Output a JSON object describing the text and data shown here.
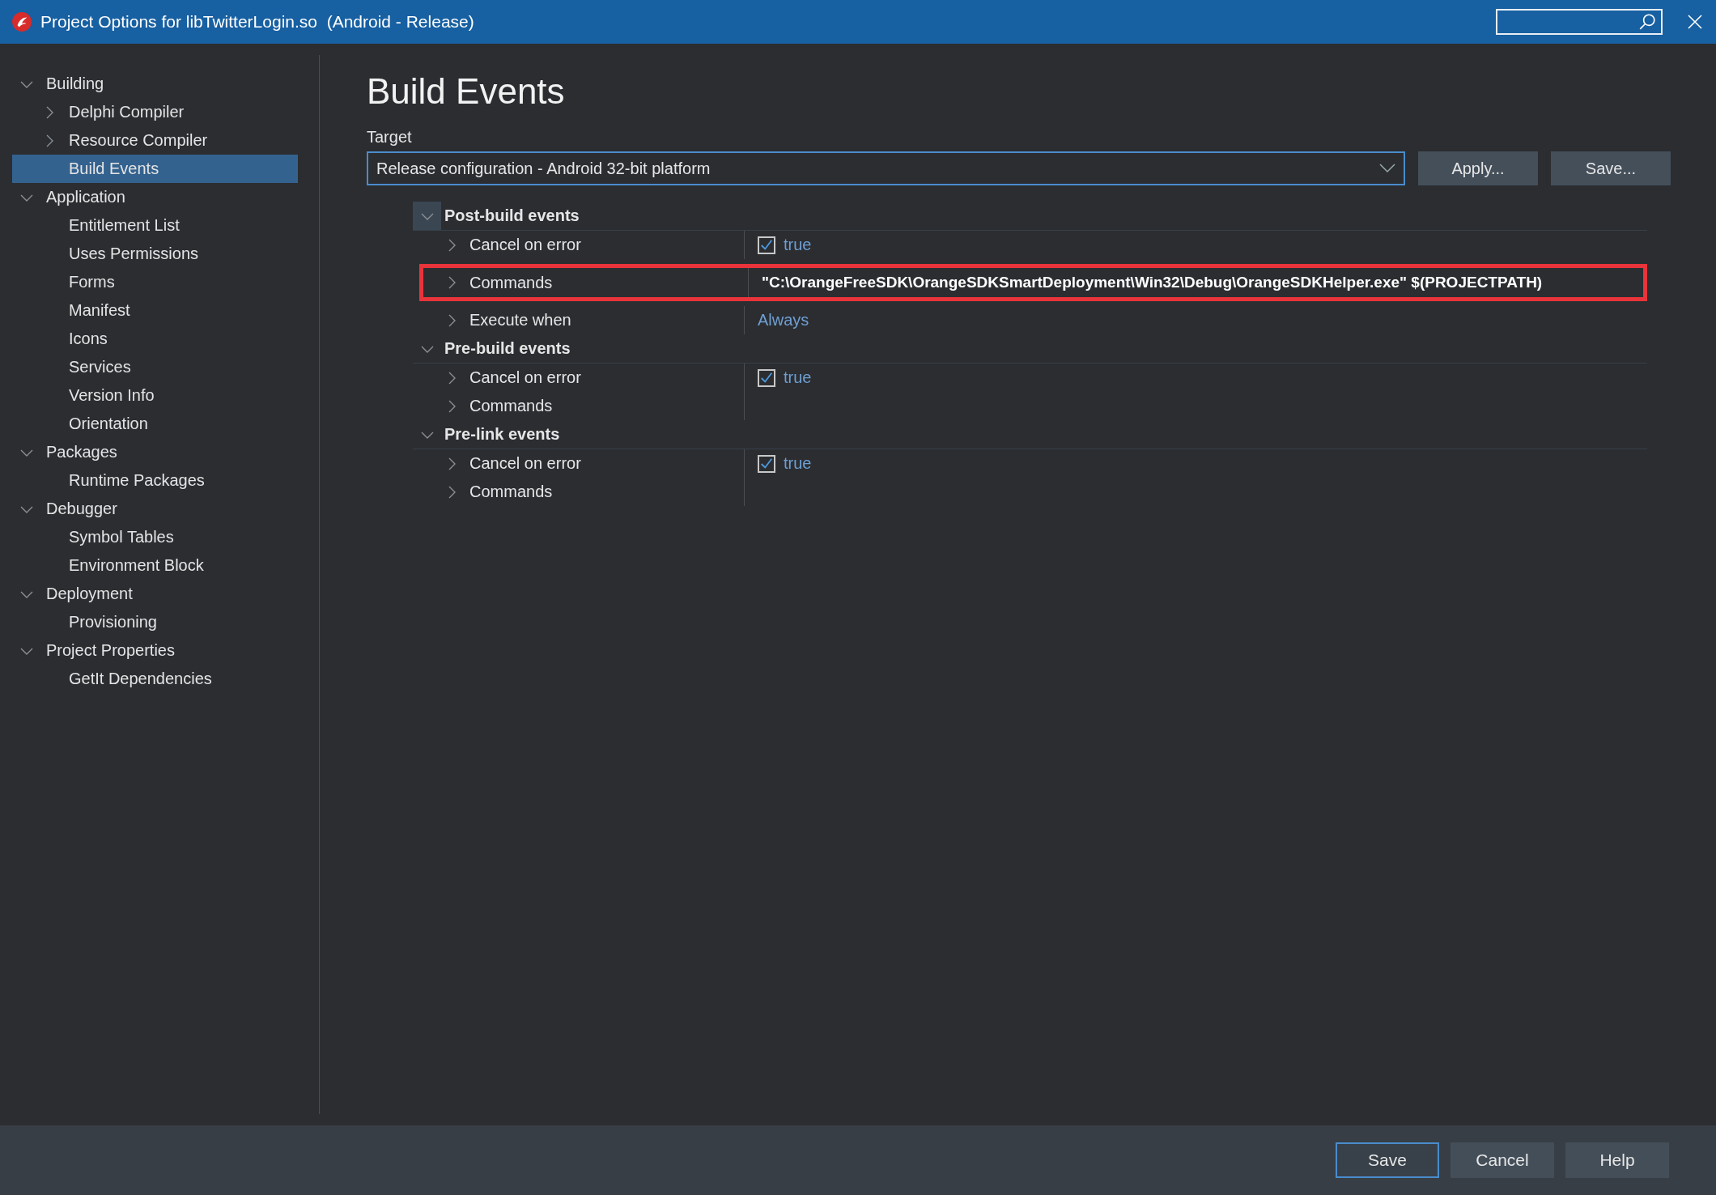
{
  "window": {
    "title": "Project Options for libTwitterLogin.so  (Android - Release)"
  },
  "sidebar": {
    "items": [
      {
        "label": "Building",
        "expanded": true,
        "selected": false,
        "children": [
          {
            "label": "Delphi Compiler",
            "expanded": false,
            "selected": false
          },
          {
            "label": "Resource Compiler",
            "expanded": false,
            "selected": false
          },
          {
            "label": "Build Events",
            "selected": true
          }
        ]
      },
      {
        "label": "Application",
        "expanded": true,
        "selected": false,
        "children": [
          {
            "label": "Entitlement List",
            "selected": false
          },
          {
            "label": "Uses Permissions",
            "selected": false
          },
          {
            "label": "Forms",
            "selected": false
          },
          {
            "label": "Manifest",
            "selected": false
          },
          {
            "label": "Icons",
            "selected": false
          },
          {
            "label": "Services",
            "selected": false
          },
          {
            "label": "Version Info",
            "selected": false
          },
          {
            "label": "Orientation",
            "selected": false
          }
        ]
      },
      {
        "label": "Packages",
        "expanded": true,
        "selected": false,
        "children": [
          {
            "label": "Runtime Packages",
            "selected": false
          }
        ]
      },
      {
        "label": "Debugger",
        "expanded": true,
        "selected": false,
        "children": [
          {
            "label": "Symbol Tables",
            "selected": false
          },
          {
            "label": "Environment Block",
            "selected": false
          }
        ]
      },
      {
        "label": "Deployment",
        "expanded": true,
        "selected": false,
        "children": [
          {
            "label": "Provisioning",
            "selected": false
          }
        ]
      },
      {
        "label": "Project Properties",
        "expanded": true,
        "selected": false,
        "children": [
          {
            "label": "GetIt Dependencies",
            "selected": false
          }
        ]
      }
    ]
  },
  "heading": "Build Events",
  "target": {
    "label": "Target",
    "value": "Release configuration - Android 32-bit platform"
  },
  "target_buttons": [
    {
      "label": "Apply..."
    },
    {
      "label": "Save..."
    }
  ],
  "events": [
    {
      "label": "Post-build events",
      "expanded": true,
      "focused": true,
      "properties": [
        {
          "label": "Cancel on error",
          "kind": "checkbox",
          "checked": true,
          "value": "true",
          "modified": false,
          "highlighted": false
        },
        {
          "label": "Commands",
          "kind": "text",
          "value": "\"C:\\OrangeFreeSDK\\OrangeSDKSmartDeployment\\Win32\\Debug\\OrangeSDKHelper.exe\" $(PROJECTPATH)",
          "modified": true,
          "highlighted": true
        },
        {
          "label": "Execute when",
          "kind": "text",
          "value": "Always",
          "modified": false,
          "highlighted": false
        }
      ]
    },
    {
      "label": "Pre-build events",
      "expanded": true,
      "focused": false,
      "properties": [
        {
          "label": "Cancel on error",
          "kind": "checkbox",
          "checked": true,
          "value": "true",
          "modified": false,
          "highlighted": false
        },
        {
          "label": "Commands",
          "kind": "text",
          "highlighted": false
        }
      ]
    },
    {
      "label": "Pre-link events",
      "expanded": true,
      "focused": false,
      "properties": [
        {
          "label": "Cancel on error",
          "kind": "checkbox",
          "checked": true,
          "value": "true",
          "modified": false,
          "highlighted": false
        },
        {
          "label": "Commands",
          "kind": "text",
          "highlighted": false
        }
      ]
    }
  ],
  "dialog_buttons": [
    {
      "label": "Save",
      "default": true
    },
    {
      "label": "Cancel",
      "default": false
    },
    {
      "label": "Help",
      "default": false
    }
  ]
}
